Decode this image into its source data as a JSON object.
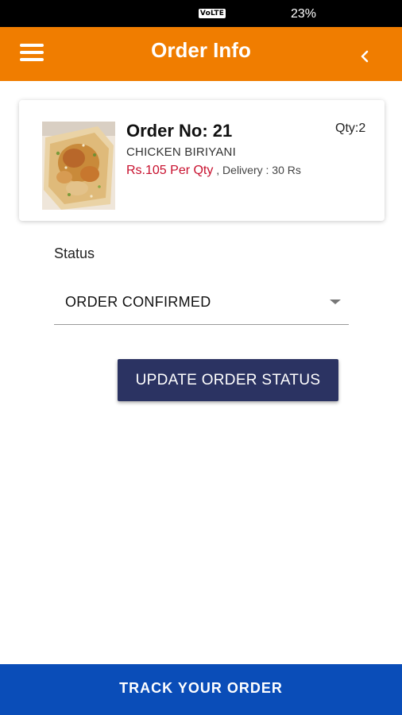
{
  "status_bar": {
    "network": "VoLTE",
    "battery": "23%"
  },
  "app_bar": {
    "title": "Order Info",
    "menu_icon": "menu-icon",
    "back_icon": "chevron-left-icon"
  },
  "order": {
    "order_no": "Order No: 21",
    "qty": "Qty:2",
    "item_name": "CHICKEN BIRIYANI",
    "price": "Rs.105 Per Qty",
    "delivery": " , Delivery : 30 Rs",
    "image": "food-photo"
  },
  "status": {
    "label": "Status",
    "selected": "ORDER CONFIRMED"
  },
  "buttons": {
    "update": "UPDATE ORDER STATUS",
    "track": "TRACK YOUR ORDER"
  },
  "colors": {
    "app_bar": "#f07d00",
    "update_button": "#2b3362",
    "track_bar": "#0a4db8",
    "price": "#c8102e"
  }
}
